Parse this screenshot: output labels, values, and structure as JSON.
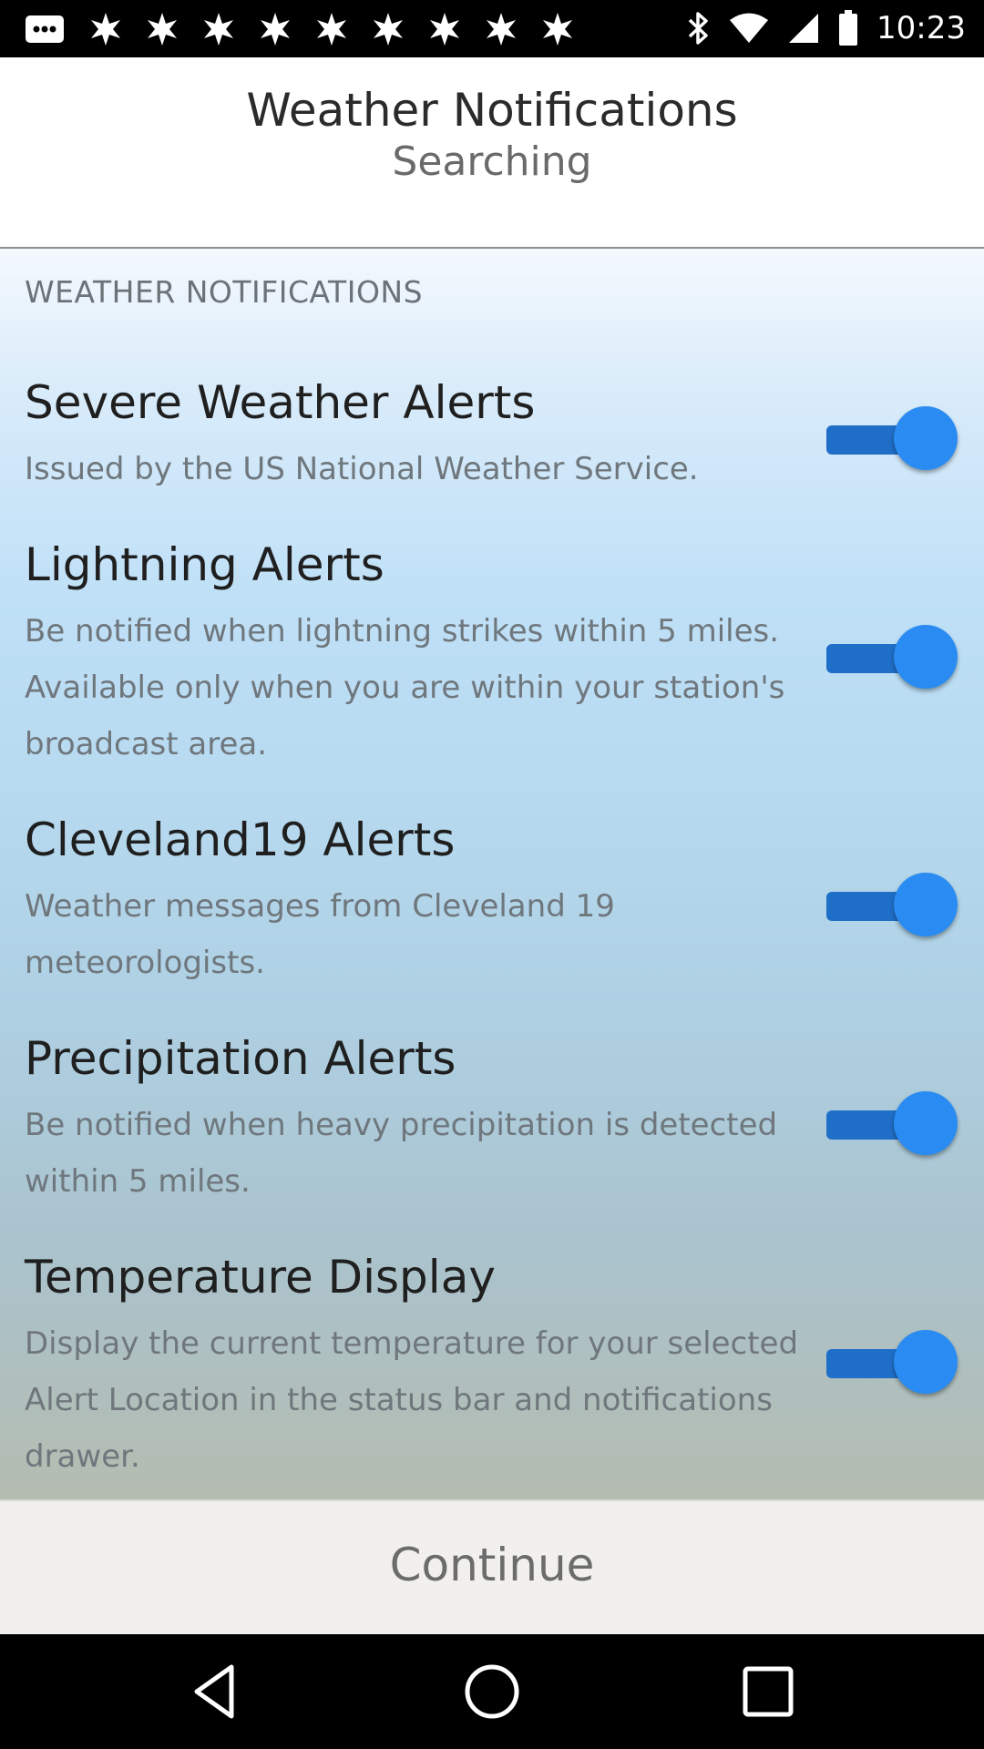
{
  "status_bar": {
    "time": "10:23",
    "notification_icons": [
      "message-icon",
      "fan-icon",
      "fan-icon",
      "fan-icon",
      "fan-icon",
      "fan-icon",
      "fan-icon",
      "fan-icon",
      "fan-icon",
      "fan-icon"
    ],
    "system_icons": [
      "bluetooth-icon",
      "wifi-icon",
      "signal-icon",
      "battery-icon"
    ]
  },
  "header": {
    "title": "Weather Notifications",
    "subtitle": "Searching"
  },
  "section": {
    "label": "WEATHER NOTIFICATIONS"
  },
  "settings": [
    {
      "title": "Severe Weather Alerts",
      "description": "Issued by the US National Weather Service.",
      "enabled": true
    },
    {
      "title": "Lightning Alerts",
      "description": "Be notified when lightning strikes within 5 miles. Available only when you are within your station's broadcast area.",
      "enabled": true
    },
    {
      "title": "Cleveland19 Alerts",
      "description": "Weather messages from Cleveland 19 meteorologists.",
      "enabled": true
    },
    {
      "title": "Precipitation Alerts",
      "description": "Be notified when heavy precipitation is detected within 5 miles.",
      "enabled": true
    },
    {
      "title": "Temperature Display",
      "description": "Display the current temperature for your selected Alert Location in the status bar and notifications drawer.",
      "enabled": true
    }
  ],
  "footer": {
    "continue_label": "Continue"
  },
  "nav_bar": {
    "buttons": [
      "back-icon",
      "home-icon",
      "recents-icon"
    ]
  },
  "colors": {
    "toggle_track": "#1f6ec7",
    "toggle_thumb": "#2a8cf2",
    "header_bg": "#ffffff",
    "continue_bg": "#f1f0ec"
  }
}
